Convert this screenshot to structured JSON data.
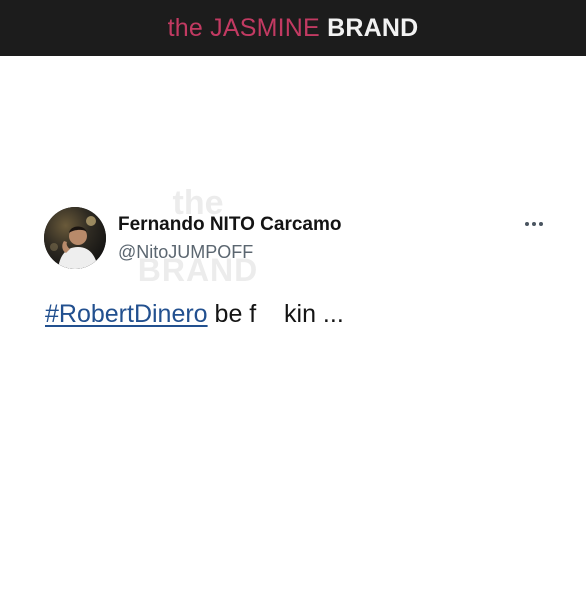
{
  "banner": {
    "brand_the": "the",
    "brand_jasmine": "JASMINE",
    "brand_brand": "BRAND"
  },
  "tweet": {
    "display_name": "Fernando NITO Carcamo",
    "handle": "@NitoJUMPOFF",
    "hashtag": "#RobertDinero",
    "text_rest": " be f    kin ...",
    "more_icon": "more-horizontal-icon"
  },
  "watermark": {
    "the": "the",
    "brand": "BRAND"
  },
  "colors": {
    "banner_bg": "#1c1c1c",
    "brand_pink": "#c23a62",
    "hashtag_blue": "#22508f",
    "handle_gray": "#5b6670"
  }
}
